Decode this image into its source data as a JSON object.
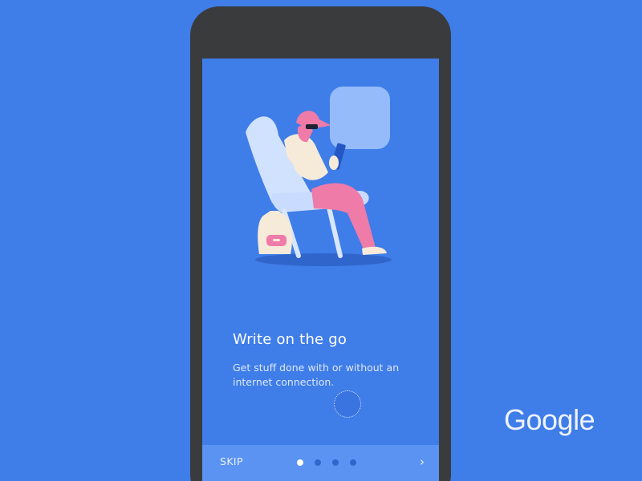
{
  "onboarding": {
    "title": "Write on the go",
    "description": "Get stuff done with or without an internet connection."
  },
  "bottom_bar": {
    "skip_label": "SKIP",
    "next_label": "›",
    "page_count": 4,
    "active_page": 1
  },
  "brand": {
    "wordmark": "Google"
  },
  "colors": {
    "background": "#3f7de8",
    "phone_frame": "#3a3b3d",
    "bottom_bar": "#5a93f2",
    "accent_pink": "#ef7ba8"
  },
  "icons": {
    "next": "chevron-right-icon"
  }
}
